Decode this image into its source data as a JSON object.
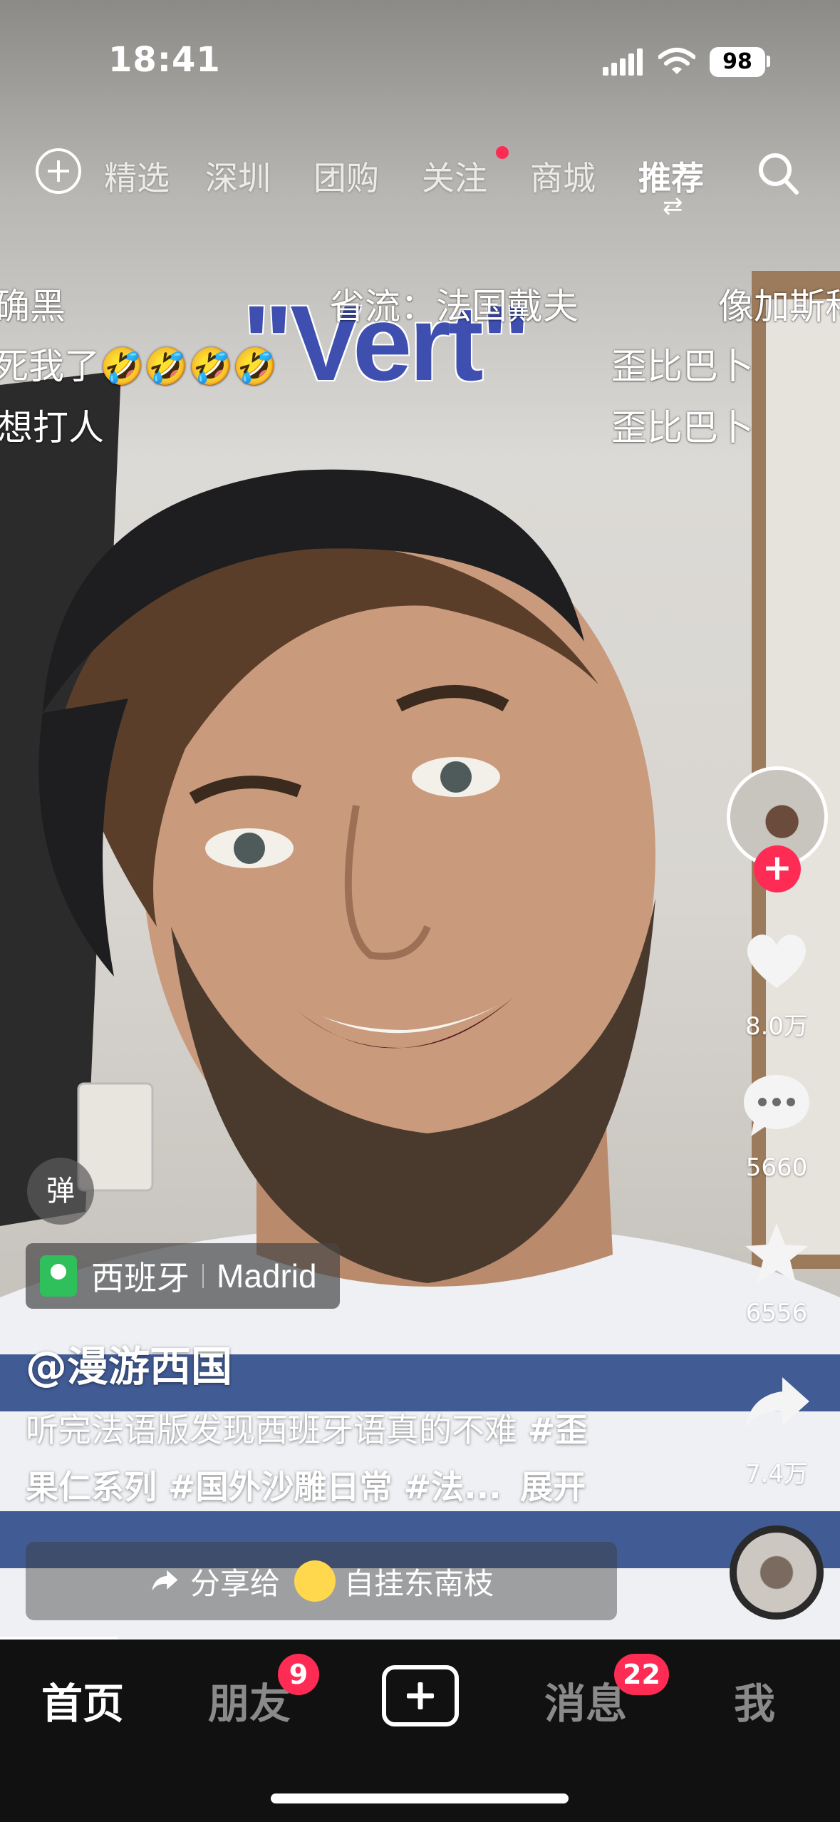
{
  "status_bar": {
    "time": "18:41",
    "battery": "98"
  },
  "top_nav": {
    "tabs": [
      "精选",
      "深圳",
      "团购",
      "关注",
      "商城",
      "推荐"
    ],
    "active_tab": "推荐"
  },
  "danmaku": {
    "row1": [
      "确黑",
      "省流：法国戴夫",
      "像加斯科"
    ],
    "row2": [
      "死我了🤣🤣🤣🤣",
      "歪比巴卜"
    ],
    "row3": [
      "想打人",
      "歪比巴卜"
    ],
    "caption_word": "\"Vert\""
  },
  "right_rail": {
    "likes": "8.0万",
    "comments": "5660",
    "favorites": "6556",
    "shares": "7.4万"
  },
  "danmaku_toggle": "弹",
  "location": {
    "country": "西班牙",
    "city": "Madrid"
  },
  "author": "@漫游西国",
  "description": {
    "line1_text": "听完法语版发现西班牙语真的不难 ",
    "line1_tag": "#歪",
    "line2_tags": "果仁系列 #国外沙雕日常 #法...",
    "expand": "展开"
  },
  "share_bar": {
    "label": "分享给",
    "friend": "自挂东南枝"
  },
  "progress": 0.14,
  "tab_bar": {
    "home": "首页",
    "friends": "朋友",
    "friends_badge": "9",
    "messages": "消息",
    "messages_badge": "22",
    "me": "我"
  },
  "colors": {
    "accent": "#fe2c55",
    "location_pin": "#2fbf5b",
    "tabbar_bg": "#111111"
  }
}
